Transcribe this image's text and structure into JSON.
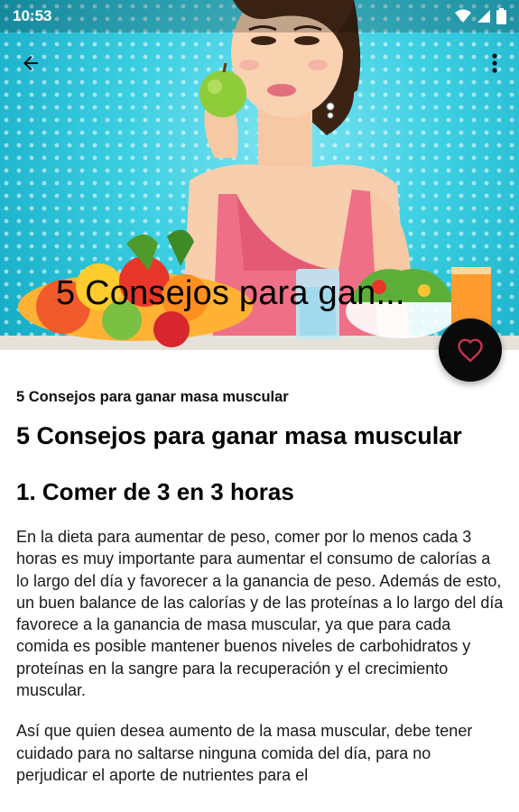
{
  "status_bar": {
    "time": "10:53",
    "icons": [
      "wifi-icon",
      "cell-signal-icon",
      "battery-icon"
    ]
  },
  "app_bar": {
    "back_icon": "arrow-left-icon",
    "menu_icon": "more-vert-icon"
  },
  "hero": {
    "title": "5 Consejos para gan..."
  },
  "fab": {
    "icon": "heart-outline-icon",
    "icon_color": "#c2334d",
    "background": "#0a0a0a"
  },
  "article": {
    "breadcrumb": "5 Consejos para ganar masa muscular",
    "title": "5 Consejos para ganar masa muscular",
    "section_heading": "1. Comer de 3 en 3 horas",
    "paragraphs": [
      "En la dieta para aumentar de peso, comer por lo menos cada 3 horas es muy importante para aumentar el consumo de calorías a lo largo del día y favorecer a la ganancia de peso. Además de esto, un buen balance de las calorías y de las proteínas a lo largo del día favorece a la ganancia de masa muscular, ya que para cada comida es posible mantener buenos niveles de carbohidratos y proteínas en la sangre para la recuperación y el crecimiento muscular.",
      "Así que quien desea aumento de la masa muscular, debe tener cuidado para no saltarse ninguna comida del día, para no perjudicar el aporte de nutrientes para el"
    ]
  },
  "colors": {
    "hero_background": "#3ccfe2",
    "text": "#1a1a1a"
  }
}
